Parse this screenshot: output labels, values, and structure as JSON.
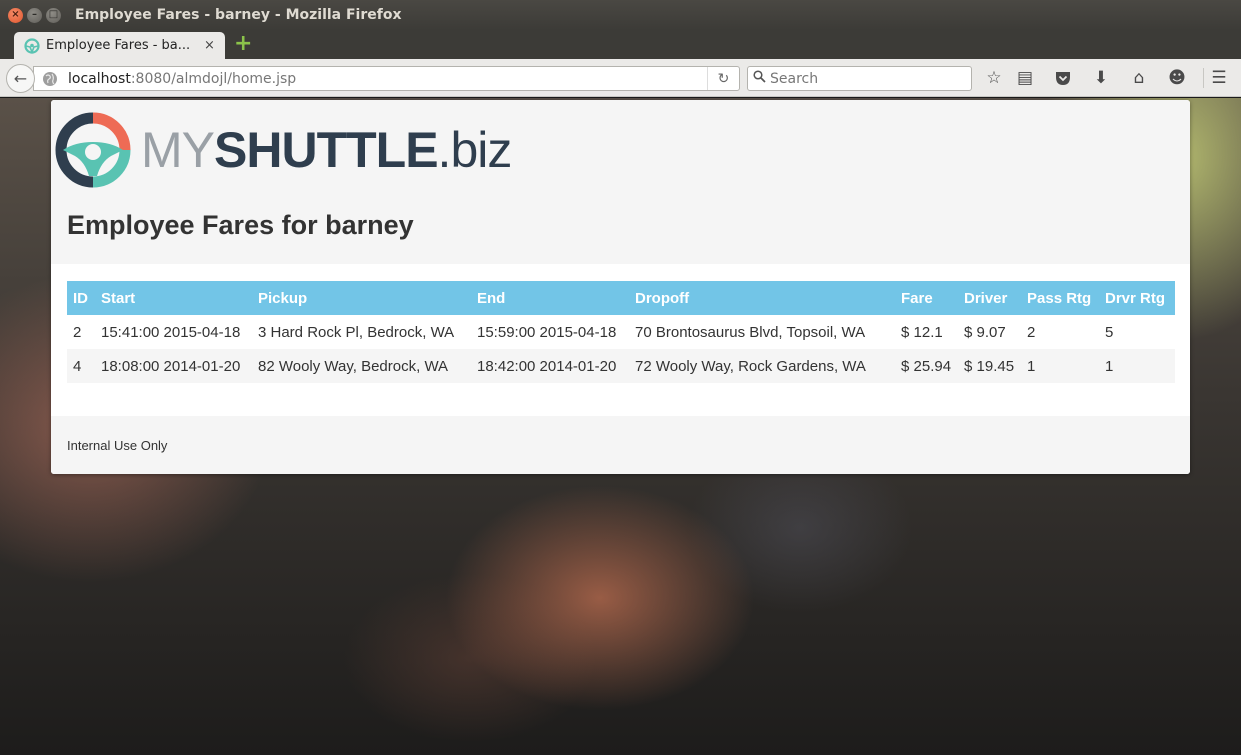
{
  "window": {
    "title": "Employee Fares - barney - Mozilla Firefox",
    "close_glyph": "×",
    "minimize_glyph": "–",
    "maximize_glyph": "□"
  },
  "tab": {
    "label": "Employee Fares - ba...",
    "close_glyph": "×",
    "new_tab_glyph": "+"
  },
  "navbar": {
    "back_glyph": "←",
    "url_host": "localhost",
    "url_rest": ":8080/almdojl/home.jsp",
    "reload_glyph": "↻",
    "search_placeholder": "Search",
    "search_glyph": "⚲",
    "icons": {
      "bookmark_star": "☆",
      "reading_list": "▤",
      "pocket": "◡",
      "downloads": "⬇",
      "home": "⌂",
      "chat": "☻",
      "menu": "☰"
    }
  },
  "brand": {
    "my": "MY",
    "shuttle": "SHUTTLE",
    "biz": ".biz",
    "colors": {
      "wheel_dark": "#2f3e4e",
      "wheel_teal": "#59c3b2",
      "wheel_coral": "#ee6b55",
      "text_light": "#9aa0a6"
    }
  },
  "page": {
    "title": "Employee Fares for barney",
    "footer": "Internal Use Only"
  },
  "table": {
    "header_color": "#72c5e7",
    "headers": {
      "id": "ID",
      "start": "Start",
      "pickup": "Pickup",
      "end": "End",
      "dropoff": "Dropoff",
      "fare": "Fare",
      "driver": "Driver",
      "pass_rtg": "Pass Rtg",
      "drvr_rtg": "Drvr Rtg"
    },
    "rows": [
      {
        "id": "2",
        "start": "15:41:00 2015-04-18",
        "pickup": "3 Hard Rock Pl, Bedrock, WA",
        "end": "15:59:00 2015-04-18",
        "dropoff": "70 Brontosaurus Blvd, Topsoil, WA",
        "fare": "$ 12.1",
        "driver": "$ 9.07",
        "pass_rtg": "2",
        "drvr_rtg": "5"
      },
      {
        "id": "4",
        "start": "18:08:00 2014-01-20",
        "pickup": "82 Wooly Way, Bedrock, WA",
        "end": "18:42:00 2014-01-20",
        "dropoff": "72 Wooly Way, Rock Gardens, WA",
        "fare": "$ 25.94",
        "driver": "$ 19.45",
        "pass_rtg": "1",
        "drvr_rtg": "1"
      }
    ]
  }
}
